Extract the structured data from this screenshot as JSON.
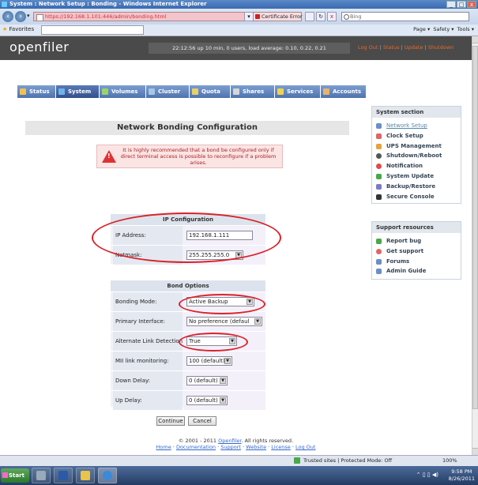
{
  "window": {
    "title": "System : Network Setup : Bonding - Windows Internet Explorer",
    "min": "_",
    "max": "□",
    "close": "x"
  },
  "browser": {
    "back": "‹",
    "forward": "›",
    "dropdown": "▾",
    "url": "https://192.168.1.101:446/admin/bonding.html",
    "cert_error": "Certificate Error",
    "refresh": "↻",
    "stop": "x",
    "search_placeholder": "Bing",
    "favorites": "Favorites",
    "tab_title": "System : Network Setup : Bonding",
    "toolbar": [
      "Page ▾",
      "Safety ▾",
      "Tools ▾"
    ]
  },
  "header": {
    "logo": "openfiler",
    "uptime": "22:12:56 up 10 min, 0 users, load average: 0.10, 0.22, 0.21",
    "links": [
      "Log Out",
      "Status",
      "Update",
      "Shutdown"
    ],
    "sep": "|"
  },
  "tabs": [
    {
      "label": "Status",
      "color": "#f2c14e"
    },
    {
      "label": "System",
      "color": "#6fb3e8"
    },
    {
      "label": "Volumes",
      "color": "#9bd36a"
    },
    {
      "label": "Cluster",
      "color": "#a7c6e6"
    },
    {
      "label": "Quota",
      "color": "#e9d06a"
    },
    {
      "label": "Shares",
      "color": "#d6d6d6"
    },
    {
      "label": "Services",
      "color": "#f2d34e"
    },
    {
      "label": "Accounts",
      "color": "#e8b46a"
    }
  ],
  "main": {
    "title": "Network Bonding Configuration",
    "warning": "It is highly recommended that a bond be configured only if direct terminal access is possible to reconfigure if a problem arises.",
    "warning_mark": "!",
    "ip_config": {
      "heading": "IP Configuration",
      "ip_label": "IP Address:",
      "ip_value": "192.168.1.111",
      "netmask_label": "Netmask:",
      "netmask_value": "255.255.255.0"
    },
    "bond_options": {
      "heading": "Bond Options",
      "rows": [
        {
          "label": "Bonding Mode:",
          "value": "Active Backup"
        },
        {
          "label": "Primary Interface:",
          "value": "No preference (defaul"
        },
        {
          "label": "Alternate Link Detection:",
          "value": "True"
        },
        {
          "label": "MII link monitoring:",
          "value": "100 (default)"
        },
        {
          "label": "Down Delay:",
          "value": "0 (default)"
        },
        {
          "label": "Up Delay:",
          "value": "0 (default)"
        }
      ]
    },
    "continue_label": "Continue",
    "cancel_label": "Cancel"
  },
  "sidebar": {
    "system_title": "System section",
    "system_items": [
      {
        "label": "Network Setup",
        "color": "#6a8fc9"
      },
      {
        "label": "Clock Setup",
        "color": "#d66"
      },
      {
        "label": "UPS Management",
        "color": "#e9a23b"
      },
      {
        "label": "Shutdown/Reboot",
        "color": "#555"
      },
      {
        "label": "Notification",
        "color": "#e04a4a"
      },
      {
        "label": "System Update",
        "color": "#49a84a"
      },
      {
        "label": "Backup/Restore",
        "color": "#7a7ac9"
      },
      {
        "label": "Secure Console",
        "color": "#333"
      }
    ],
    "support_title": "Support resources",
    "support_items": [
      {
        "label": "Report bug",
        "color": "#49a84a"
      },
      {
        "label": "Get support",
        "color": "#d66"
      },
      {
        "label": "Forums",
        "color": "#6a8fc9"
      },
      {
        "label": "Admin Guide",
        "color": "#6a8fc9"
      }
    ]
  },
  "footer": {
    "copyright_pre": "© 2001 - 2011 ",
    "copyright_link": "Openfiler",
    "copyright_post": ". All rights reserved.",
    "links": [
      "Home",
      "Documentation",
      "Support",
      "Website",
      "License",
      "Log Out"
    ],
    "sep": " · "
  },
  "statusbar": {
    "zone": "Trusted sites | Protected Mode: Off",
    "zoom": "100%"
  },
  "taskbar": {
    "start": "Start",
    "time": "9:58 PM",
    "date": "8/26/2011",
    "tray": "⌃ ▯ ▯ ◀)"
  }
}
